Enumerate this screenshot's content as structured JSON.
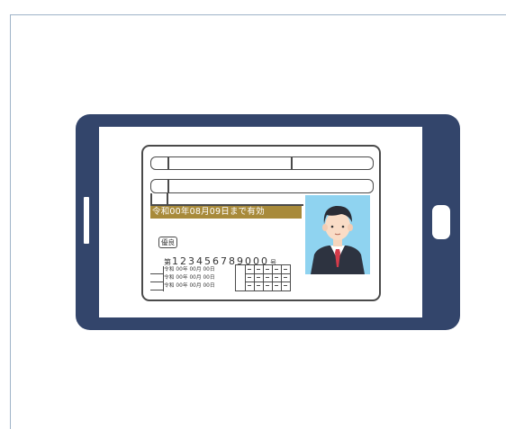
{
  "card": {
    "validity_text": "令和00年08月09日まで有効",
    "badge_label": "優良",
    "number_prefix": "第",
    "number_value": "123456789000",
    "number_suffix": "号",
    "dates": [
      "令和 00年 00月 00日",
      "令和 00年 00月 00日",
      "令和 00年 00月 00日"
    ]
  },
  "colors": {
    "phone_body": "#33456b",
    "validity_band": "#a88a3a",
    "photo_background": "#8fd3f0",
    "tie": "#d63b4a",
    "suit": "#2d3340"
  }
}
